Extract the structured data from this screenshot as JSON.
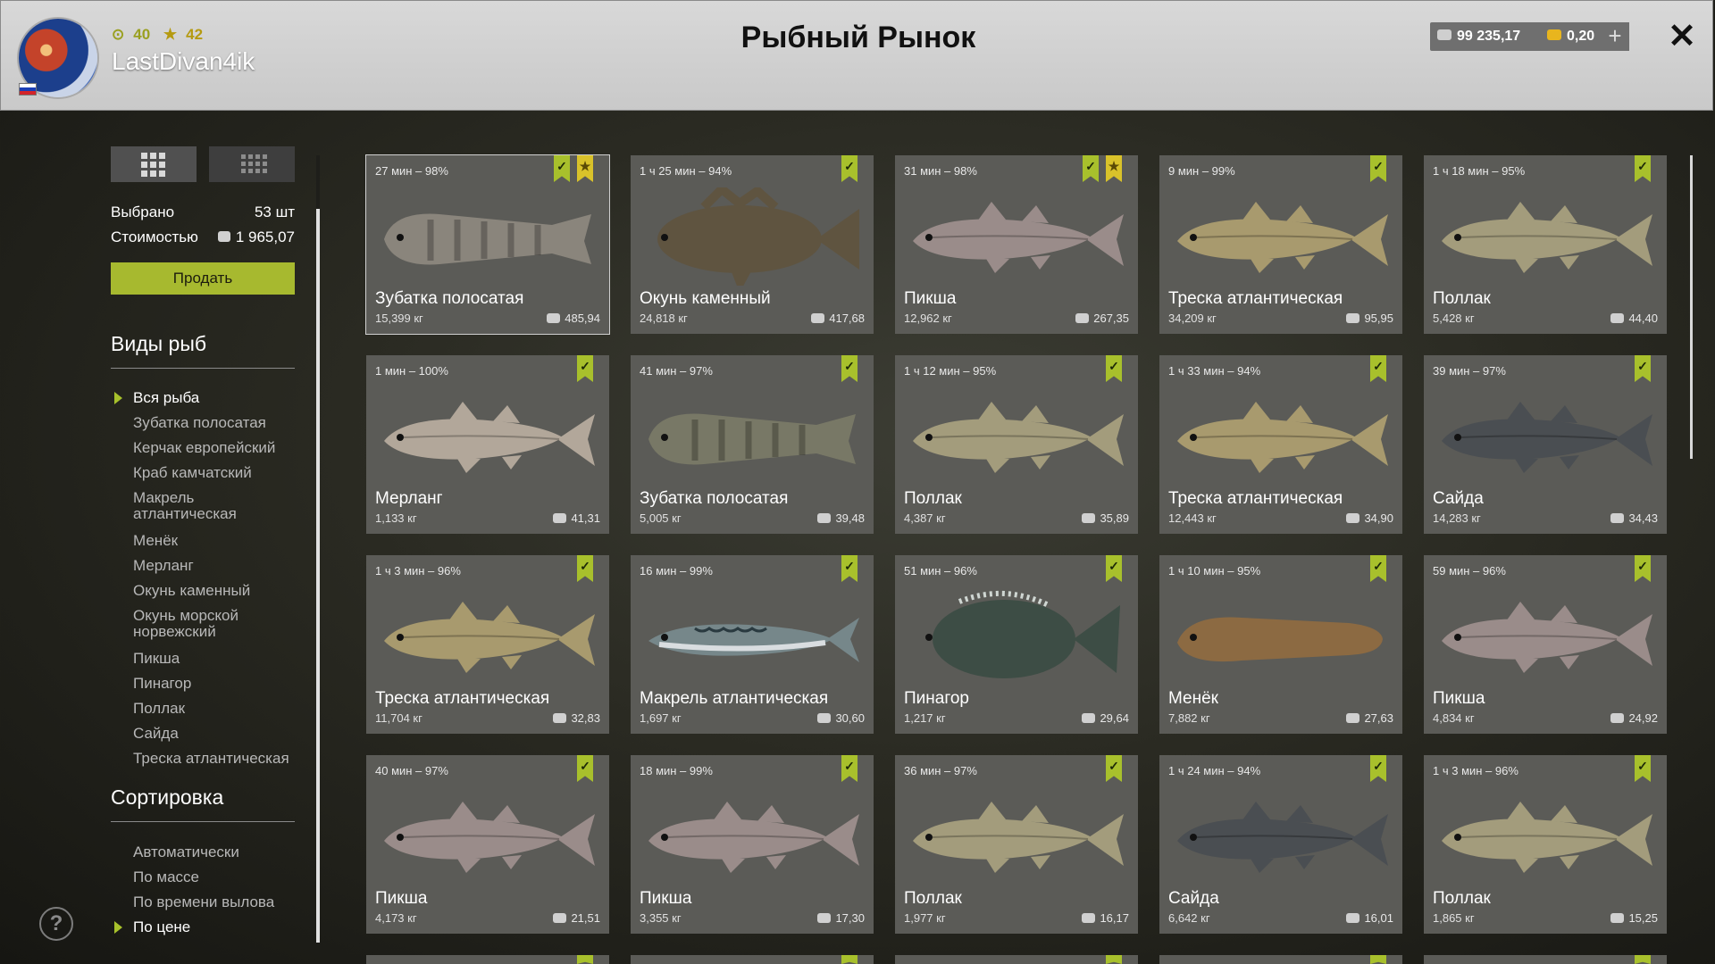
{
  "header": {
    "title": "Рыбный Рынок",
    "level": "40",
    "rating": "42",
    "username": "LastDivan4ik",
    "silver": "99 235,17",
    "gold": "0,20",
    "add": "+",
    "close": "✕"
  },
  "sidebar": {
    "selected_label": "Выбрано",
    "selected_value": "53 шт",
    "cost_label": "Стоимостью",
    "cost_value": "1 965,07",
    "sell_button": "Продать",
    "species_title": "Виды рыб",
    "species": [
      {
        "label": "Вся рыба",
        "active": true
      },
      {
        "label": "Зубатка полосатая"
      },
      {
        "label": "Керчак европейский"
      },
      {
        "label": "Краб камчатский"
      },
      {
        "label": "Макрель атлантическая"
      },
      {
        "label": "Менёк"
      },
      {
        "label": "Мерланг"
      },
      {
        "label": "Окунь каменный"
      },
      {
        "label": "Окунь морской норвежский"
      },
      {
        "label": "Пикша"
      },
      {
        "label": "Пинагор"
      },
      {
        "label": "Поллак"
      },
      {
        "label": "Сайда"
      },
      {
        "label": "Треска атлантическая"
      }
    ],
    "sort_title": "Сортировка",
    "sort": [
      {
        "label": "Автоматически"
      },
      {
        "label": "По массе"
      },
      {
        "label": "По времени вылова"
      },
      {
        "label": "По цене",
        "active": true
      }
    ],
    "help": "?"
  },
  "fish": [
    {
      "time": "27 мин – 98%",
      "name": "Зубатка полосатая",
      "weight": "15,399 кг",
      "price": "485,94",
      "fav": true,
      "selected": true,
      "kind": "wolffish",
      "color": "#8a857c"
    },
    {
      "time": "1 ч 25 мин – 94%",
      "name": "Окунь каменный",
      "weight": "24,818 кг",
      "price": "417,68",
      "fav": false,
      "kind": "perch",
      "color": "#5f5440"
    },
    {
      "time": "31 мин – 98%",
      "name": "Пикша",
      "weight": "12,962 кг",
      "price": "267,35",
      "fav": true,
      "kind": "haddock",
      "color": "#9a8c8a"
    },
    {
      "time": "9 мин – 99%",
      "name": "Треска атлантическая",
      "weight": "34,209 кг",
      "price": "95,95",
      "fav": false,
      "kind": "cod",
      "color": "#a89a6e"
    },
    {
      "time": "1 ч 18 мин – 95%",
      "name": "Поллак",
      "weight": "5,428 кг",
      "price": "44,40",
      "fav": false,
      "kind": "pollack",
      "color": "#a39c7c"
    },
    {
      "time": "1 мин – 100%",
      "name": "Мерланг",
      "weight": "1,133 кг",
      "price": "41,31",
      "fav": false,
      "kind": "whiting",
      "color": "#b2a79a"
    },
    {
      "time": "41 мин – 97%",
      "name": "Зубатка полосатая",
      "weight": "5,005 кг",
      "price": "39,48",
      "fav": false,
      "kind": "wolffish",
      "color": "#787866"
    },
    {
      "time": "1 ч 12 мин – 95%",
      "name": "Поллак",
      "weight": "4,387 кг",
      "price": "35,89",
      "fav": false,
      "kind": "pollack",
      "color": "#a39c7c"
    },
    {
      "time": "1 ч 33 мин – 94%",
      "name": "Треска атлантическая",
      "weight": "12,443 кг",
      "price": "34,90",
      "fav": false,
      "kind": "cod",
      "color": "#a89a6e"
    },
    {
      "time": "39 мин – 97%",
      "name": "Сайда",
      "weight": "14,283 кг",
      "price": "34,43",
      "fav": false,
      "kind": "saithe",
      "color": "#4a4e52"
    },
    {
      "time": "1 ч 3 мин – 96%",
      "name": "Треска атлантическая",
      "weight": "11,704 кг",
      "price": "32,83",
      "fav": false,
      "kind": "cod",
      "color": "#a89a6e"
    },
    {
      "time": "16 мин – 99%",
      "name": "Макрель атлантическая",
      "weight": "1,697 кг",
      "price": "30,60",
      "fav": false,
      "kind": "mackerel",
      "color": "#76878a"
    },
    {
      "time": "51 мин – 96%",
      "name": "Пинагор",
      "weight": "1,217 кг",
      "price": "29,64",
      "fav": false,
      "kind": "lumpfish",
      "color": "#3d4d45"
    },
    {
      "time": "1 ч 10 мин – 95%",
      "name": "Менёк",
      "weight": "7,882 кг",
      "price": "27,63",
      "fav": false,
      "kind": "tusk",
      "color": "#8c6a42"
    },
    {
      "time": "59 мин – 96%",
      "name": "Пикша",
      "weight": "4,834 кг",
      "price": "24,92",
      "fav": false,
      "kind": "haddock",
      "color": "#9a8c8a"
    },
    {
      "time": "40 мин – 97%",
      "name": "Пикша",
      "weight": "4,173 кг",
      "price": "21,51",
      "fav": false,
      "kind": "haddock",
      "color": "#9a8c8a"
    },
    {
      "time": "18 мин – 99%",
      "name": "Пикша",
      "weight": "3,355 кг",
      "price": "17,30",
      "fav": false,
      "kind": "haddock",
      "color": "#9a8c8a"
    },
    {
      "time": "36 мин – 97%",
      "name": "Поллак",
      "weight": "1,977 кг",
      "price": "16,17",
      "fav": false,
      "kind": "pollack",
      "color": "#a39c7c"
    },
    {
      "time": "1 ч 24 мин – 94%",
      "name": "Сайда",
      "weight": "6,642 кг",
      "price": "16,01",
      "fav": false,
      "kind": "saithe",
      "color": "#4a4e52"
    },
    {
      "time": "1 ч 3 мин – 96%",
      "name": "Поллак",
      "weight": "1,865 кг",
      "price": "15,25",
      "fav": false,
      "kind": "pollack",
      "color": "#a39c7c"
    }
  ]
}
